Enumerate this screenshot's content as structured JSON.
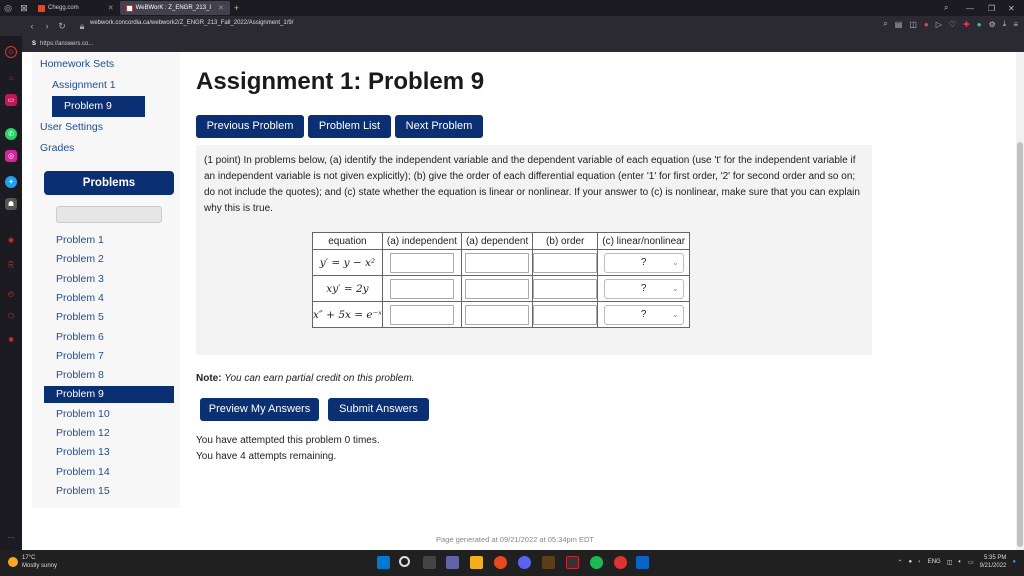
{
  "browser": {
    "tabs": [
      {
        "label": "Chegg.com",
        "active": false
      },
      {
        "label": "WeBWorK : Z_ENGR_213_I",
        "active": true
      }
    ],
    "url": "webwork.concordia.ca/webwork2/Z_ENGR_213_Fall_2022/Assignment_1/9/",
    "bookmark": "https://answers.co..."
  },
  "sidebar": {
    "homework_sets": "Homework Sets",
    "assignment": "Assignment 1",
    "current_problem": "Problem 9",
    "user_settings": "User Settings",
    "grades": "Grades",
    "problems_header": "Problems",
    "problems": [
      "Problem 1",
      "Problem 2",
      "Problem 3",
      "Problem 4",
      "Problem 5",
      "Problem 6",
      "Problem 7",
      "Problem 8",
      "Problem 9",
      "Problem 10",
      "Problem 12",
      "Problem 13",
      "Problem 14",
      "Problem 15"
    ],
    "active_problem_index": 8
  },
  "main": {
    "title": "Assignment 1: Problem 9",
    "buttons": {
      "previous": "Previous Problem",
      "list": "Problem List",
      "next": "Next Problem"
    },
    "problem_text": "(1 point) In problems below, (a) identify the independent variable and the dependent variable of each equation (use 't' for the independent variable if an independent variable is not given explicitly); (b) give the order of each differential equation (enter '1' for first order, '2' for second order and so on; do not include the quotes); and (c) state whether the equation is linear or nonlinear. If your answer to (c) is nonlinear, make sure that you can explain why this is true.",
    "table": {
      "headers": [
        "equation",
        "(a) independent",
        "(a) dependent",
        "(b) order",
        "(c) linear/nonlinear"
      ],
      "rows": [
        {
          "equation": "y′ = y − x²",
          "select": "?"
        },
        {
          "equation": "xy′ = 2y",
          "select": "?"
        },
        {
          "equation": "x″ + 5x = e⁻ˣ",
          "select": "?"
        }
      ]
    },
    "note_label": "Note:",
    "note_text": "You can earn partial credit on this problem.",
    "preview_button": "Preview My Answers",
    "submit_button": "Submit Answers",
    "attempted": "You have attempted this problem 0 times.",
    "remaining": "You have 4 attempts remaining.",
    "footer": "Page generated at 09/21/2022 at 05:34pm EDT"
  },
  "taskbar": {
    "temperature": "17°C",
    "weather": "Mostly sunny",
    "language": "ENG",
    "time": "5:35 PM",
    "date": "9/21/2022"
  }
}
